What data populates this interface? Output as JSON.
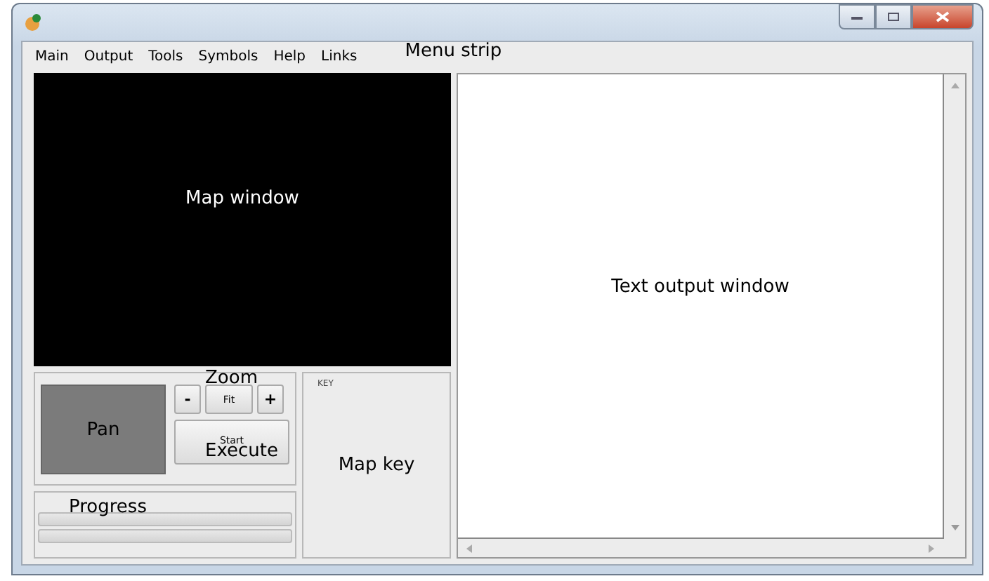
{
  "menu": [
    {
      "label": "Main"
    },
    {
      "label": "Output"
    },
    {
      "label": "Tools"
    },
    {
      "label": "Symbols"
    },
    {
      "label": "Help"
    },
    {
      "label": "Links"
    }
  ],
  "annotations": {
    "menu": "Menu strip",
    "map": "Map window",
    "zoom": "Zoom",
    "pan": "Pan",
    "execute": "Execute",
    "progress": "Progress",
    "key": "Map key",
    "output": "Text output window"
  },
  "zoom_buttons": [
    "-",
    "Fit",
    "+"
  ],
  "start_button": "Start",
  "key_label": "KEY",
  "progress_bars": [
    {
      "level": 0
    },
    {
      "level": 0
    }
  ]
}
